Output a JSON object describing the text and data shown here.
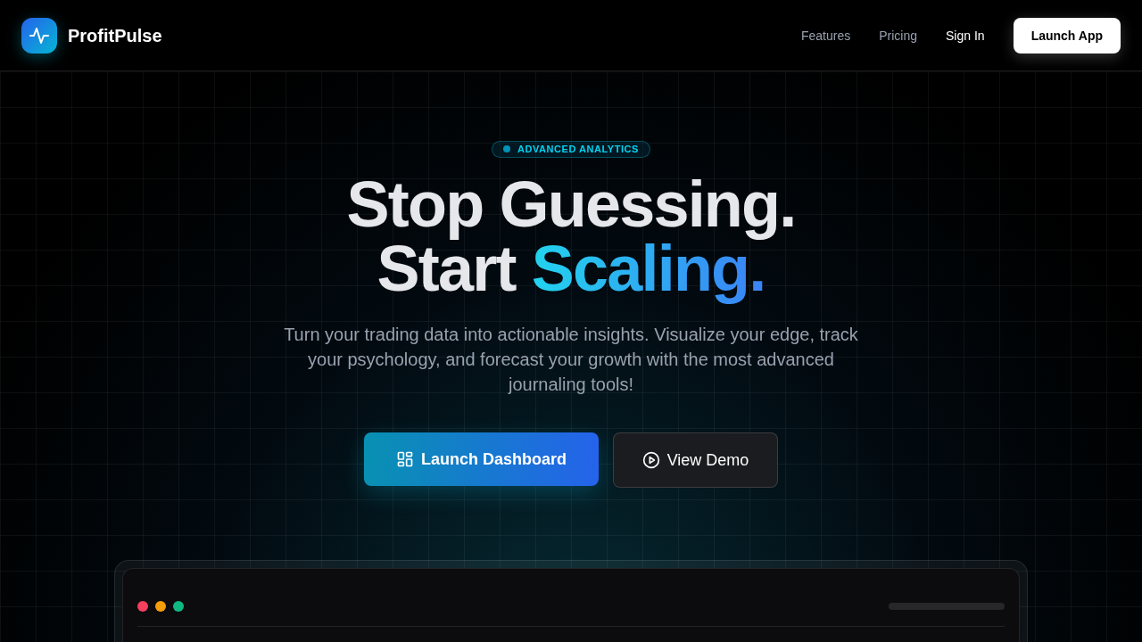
{
  "nav": {
    "brand": "ProfitPulse",
    "links": [
      {
        "label": "Features",
        "emphasis": false
      },
      {
        "label": "Pricing",
        "emphasis": false
      },
      {
        "label": "Sign In",
        "emphasis": true
      }
    ],
    "cta": "Launch App"
  },
  "hero": {
    "badge": "ADVANCED ANALYTICS",
    "headline_line_1": "Stop Guessing.",
    "headline_line_2": "Start",
    "headline_highlight": "Scaling.",
    "description": "Turn your trading data into actionable insights. Visualize your edge, track your psychology, and forecast your growth with the most advanced journaling tools!",
    "buttons": [
      {
        "kind": "primary",
        "label": "Launch Dashboard"
      },
      {
        "kind": "secondary",
        "label": "View Demo"
      }
    ]
  },
  "preview": {
    "window_dots": [
      {
        "color": "#f43f5e"
      },
      {
        "color": "#f59e0b"
      },
      {
        "color": "#10b981"
      }
    ]
  }
}
